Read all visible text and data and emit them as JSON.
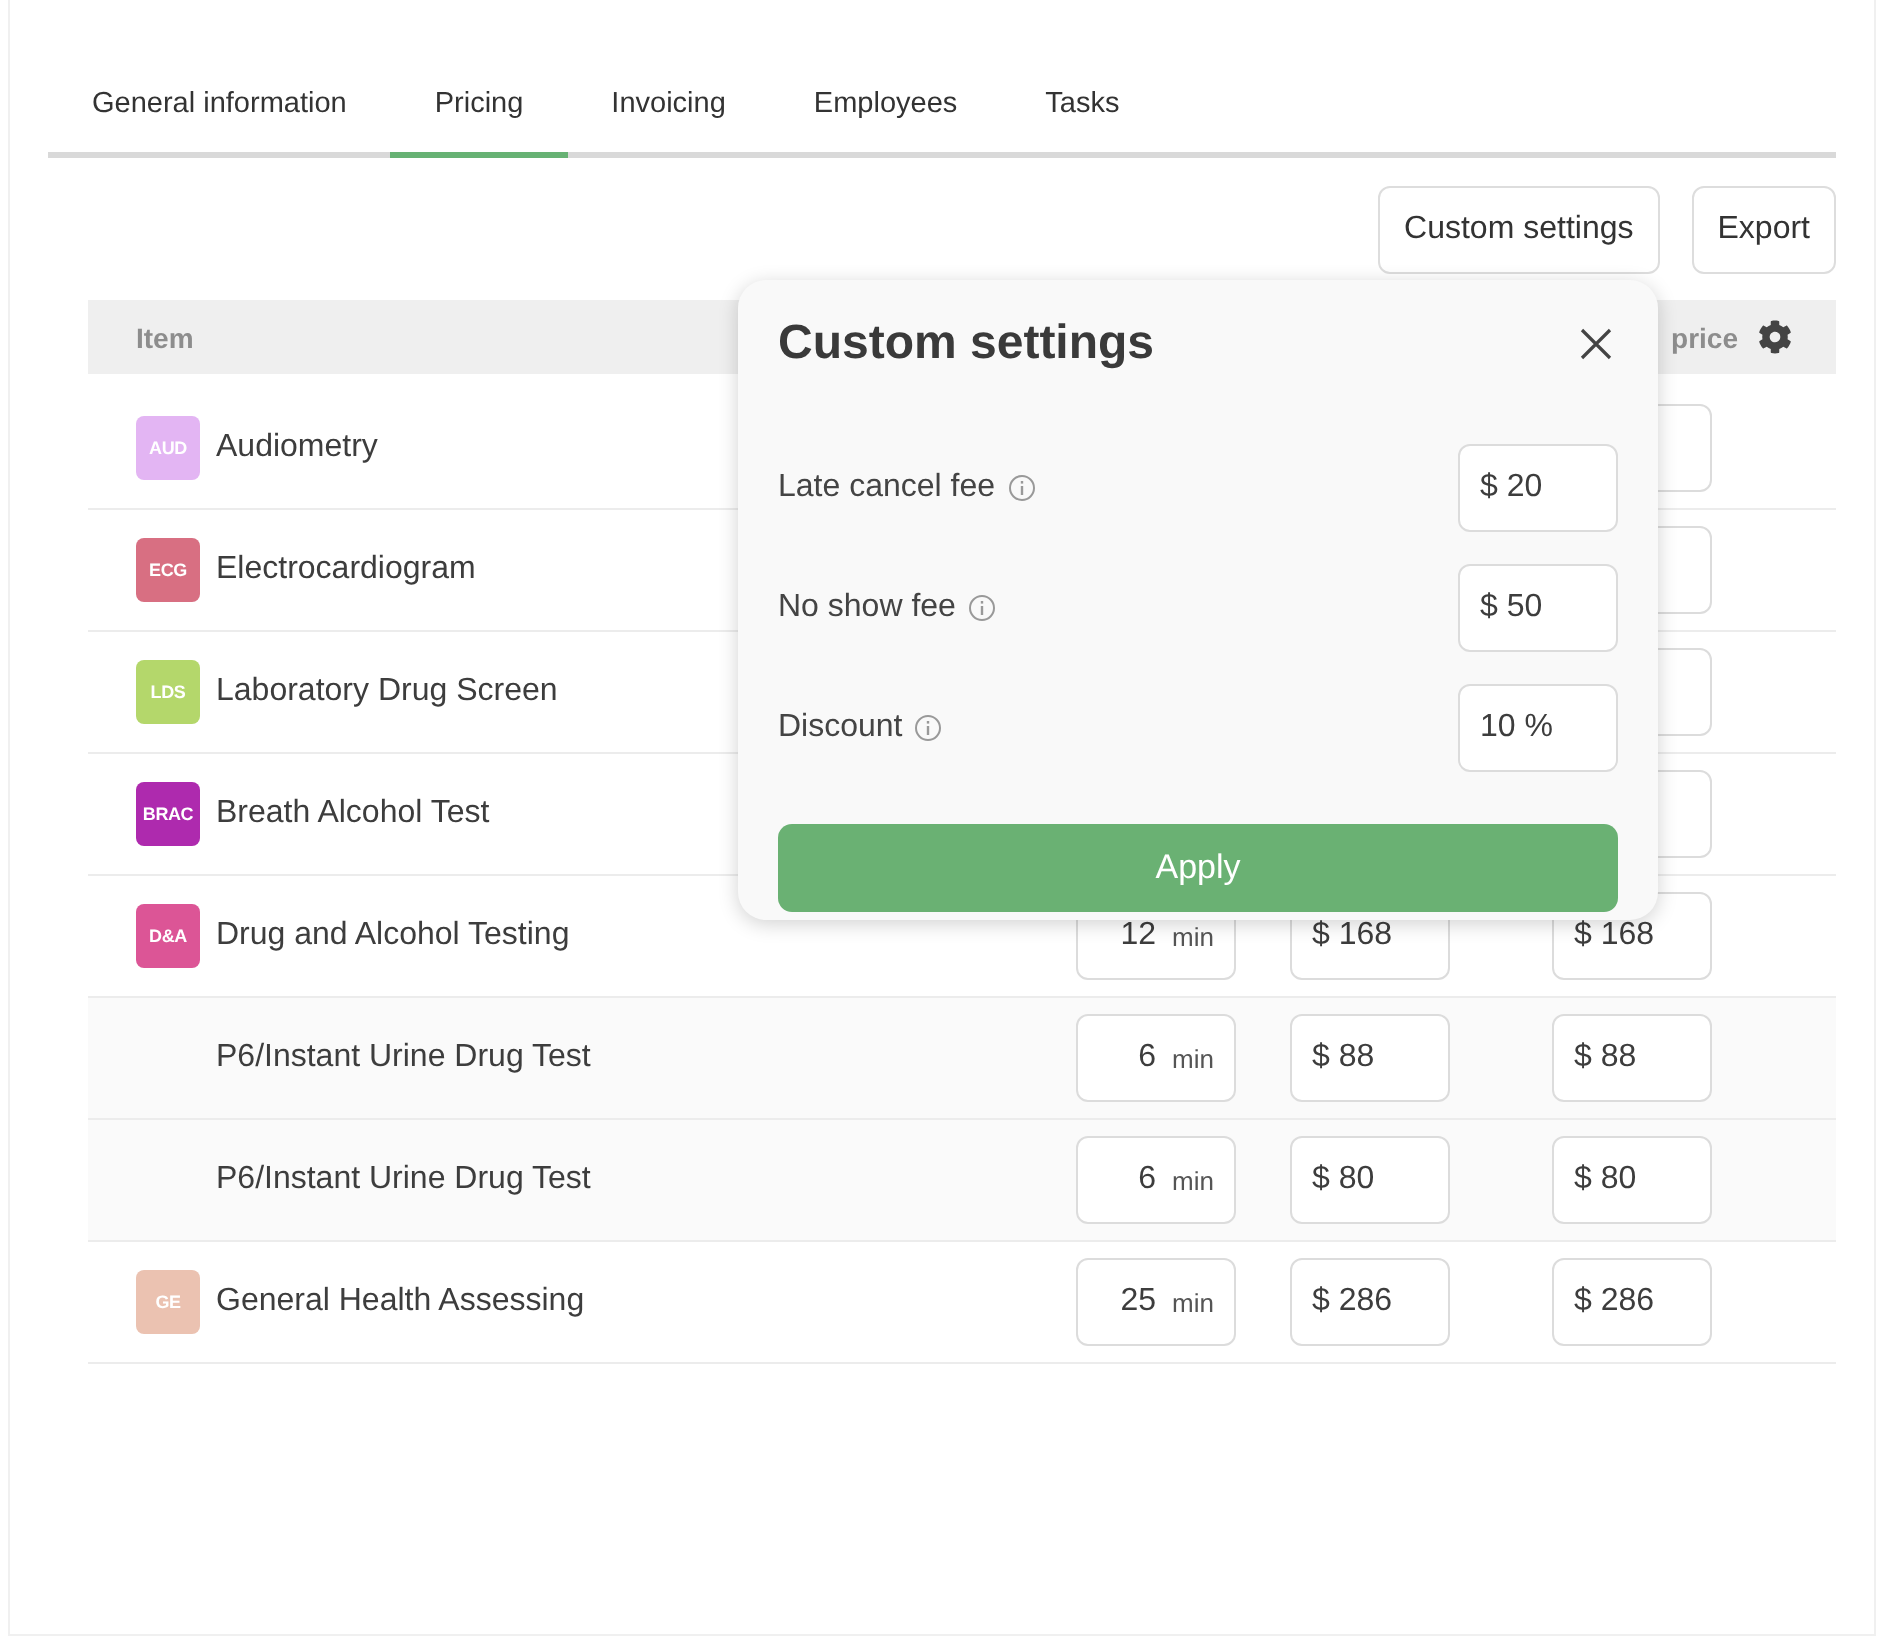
{
  "tabs": [
    {
      "label": "General information",
      "selected": false
    },
    {
      "label": "Pricing",
      "selected": true
    },
    {
      "label": "Invoicing",
      "selected": false
    },
    {
      "label": "Employees",
      "selected": false
    },
    {
      "label": "Tasks",
      "selected": false
    }
  ],
  "actions": [
    "Custom settings",
    "Export"
  ],
  "table": {
    "columns": [
      {
        "label": "Item"
      },
      {
        "label": "price"
      }
    ],
    "rows": [
      {
        "kind": "item",
        "badge": "AUD",
        "color": "#e3b5f3",
        "name": "Audiometry"
      },
      {
        "kind": "item",
        "badge": "ECG",
        "color": "#d86f82",
        "name": "Electrocardiogram"
      },
      {
        "kind": "item",
        "badge": "LDS",
        "color": "#b4d76b",
        "name": "Laboratory Drug Screen"
      },
      {
        "kind": "item",
        "badge": "BRAC",
        "color": "#ae2aae",
        "name": "Breath Alcohol Test"
      },
      {
        "kind": "item",
        "badge": "D&A",
        "color": "#dc5596",
        "name": "Drug and Alcohol Testing",
        "duration": "12",
        "unit": "min",
        "price": "$ 168",
        "final_price": "$ 168"
      },
      {
        "kind": "sub",
        "name": "P6/Instant Urine Drug Test",
        "duration": "6",
        "unit": "min",
        "price": "$ 88",
        "final_price": "$ 88"
      },
      {
        "kind": "sub",
        "name": "P6/Instant Urine Drug Test",
        "duration": "6",
        "unit": "min",
        "price": "$ 80",
        "final_price": "$ 80"
      },
      {
        "kind": "item",
        "badge": "GE",
        "color": "#ebc2b1",
        "name": "General Health Assessing",
        "duration": "25",
        "unit": "min",
        "price": "$ 286",
        "final_price": "$ 286"
      }
    ]
  },
  "popover": {
    "title": "Custom settings",
    "fields": [
      {
        "label": "Late cancel fee",
        "value": "$ 20"
      },
      {
        "label": "No show fee",
        "value": "$ 50"
      },
      {
        "label": "Discount",
        "value": "10 %"
      }
    ],
    "apply": "Apply"
  }
}
